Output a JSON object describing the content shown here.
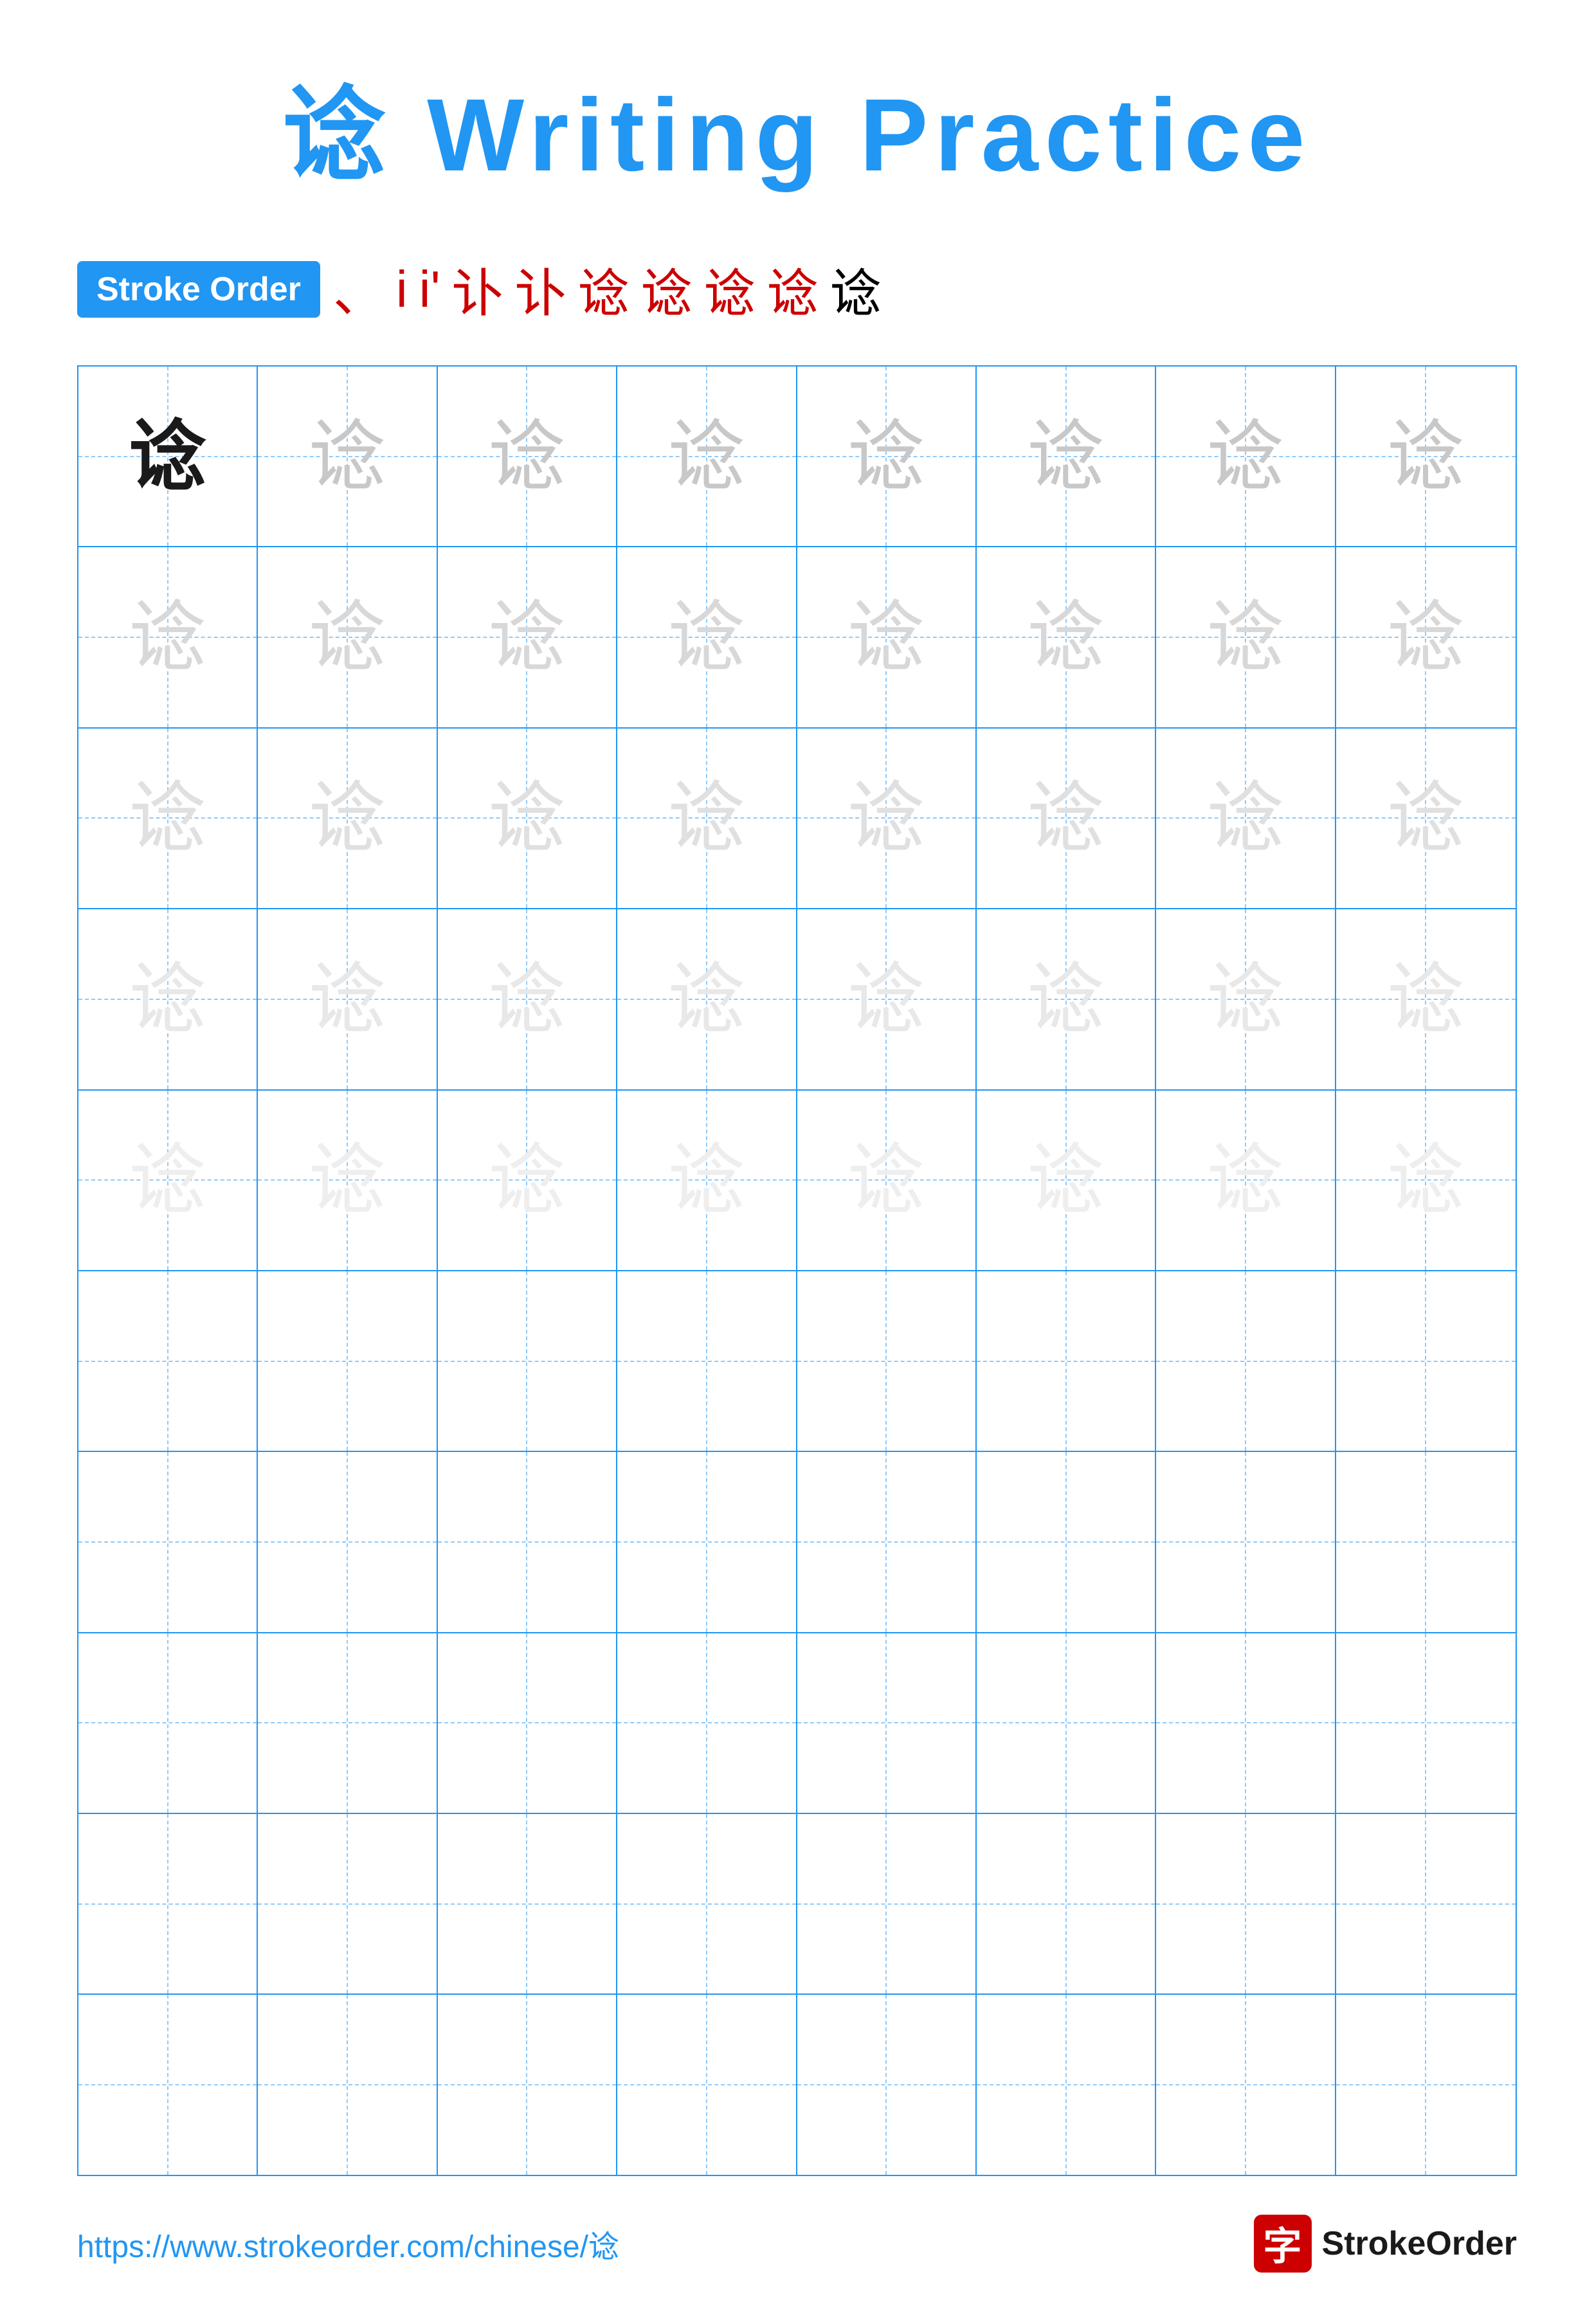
{
  "title": {
    "char": "谂",
    "text": " Writing Practice"
  },
  "stroke_order": {
    "badge_label": "Stroke Order",
    "steps": [
      "、",
      "i",
      "i'",
      "讣",
      "讣",
      "谂",
      "谂",
      "谂",
      "谂",
      "谂"
    ]
  },
  "grid": {
    "rows": 10,
    "cols": 8,
    "char": "谂",
    "practice_rows": 5,
    "empty_rows": 5
  },
  "footer": {
    "url": "https://www.strokeorder.com/chinese/谂",
    "brand": "StrokeOrder"
  },
  "colors": {
    "blue": "#2196F3",
    "red": "#cc0000",
    "dark": "#1a1a1a"
  }
}
